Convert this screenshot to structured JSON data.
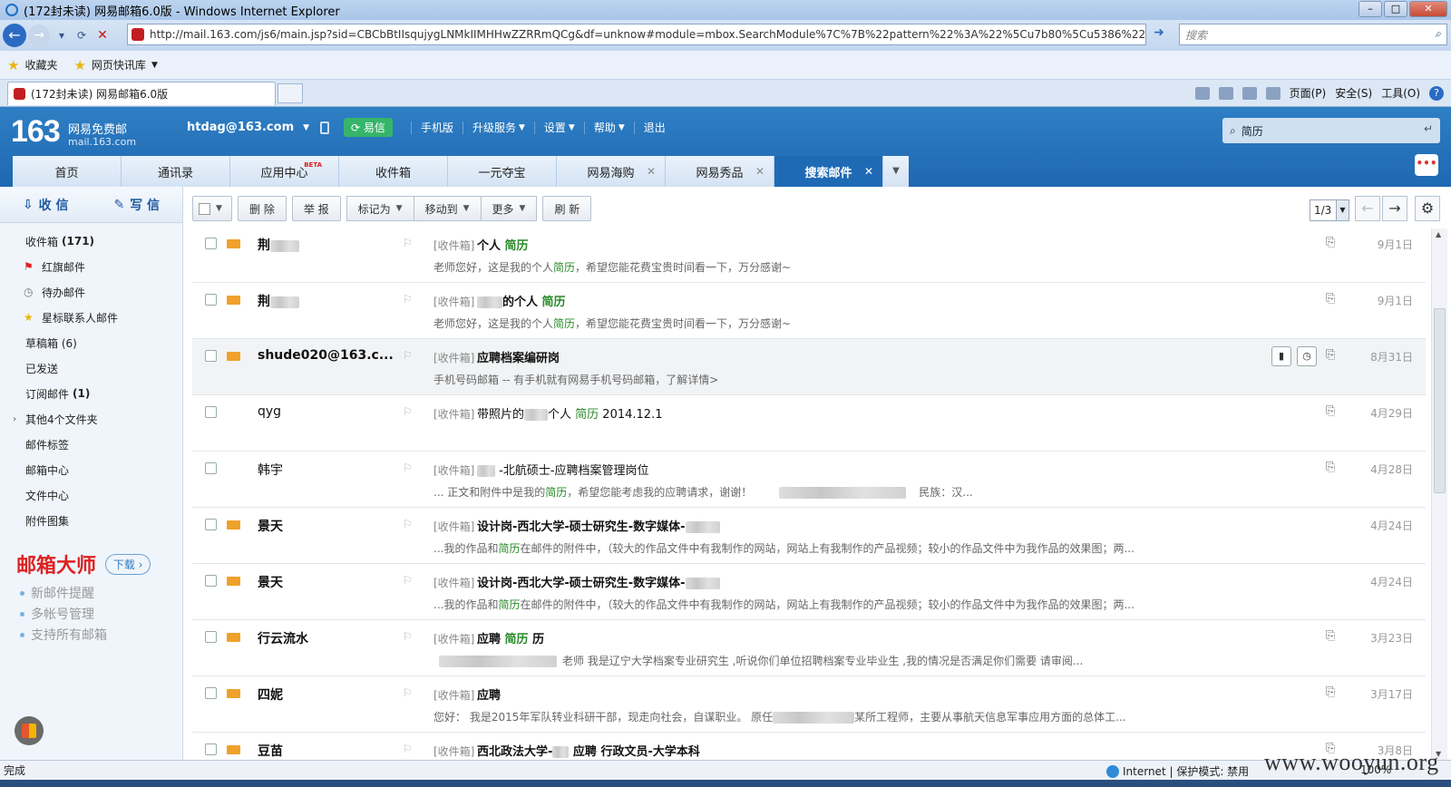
{
  "window": {
    "title": "(172封未读) 网易邮箱6.0版 - Windows Internet Explorer",
    "url": "http://mail.163.com/js6/main.jsp?sid=CBCbBtIIsqujygLNMkIIMHHwZZRRmQCg&df=unknow#module=mbox.SearchModule%7C%7B%22pattern%22%3A%22%5Cu7b80%5Cu5386%22%2C",
    "search_placeholder": "搜索",
    "favorites": "收藏夹",
    "quick_sites": "网页快讯库",
    "tab_title": "(172封未读) 网易邮箱6.0版",
    "tools": [
      "页面(P)",
      "安全(S)",
      "工具(O)"
    ]
  },
  "header": {
    "logo_num": "163",
    "logo_text": "网易免费邮",
    "logo_domain": "mail.163.com",
    "account": "htdag@163.com",
    "yixin": "易信",
    "links": [
      "手机版",
      "升级服务",
      "设置",
      "帮助",
      "退出"
    ],
    "search_value": "简历"
  },
  "tabs": [
    {
      "label": "首页",
      "closable": false,
      "badge": ""
    },
    {
      "label": "通讯录",
      "closable": false,
      "badge": ""
    },
    {
      "label": "应用中心",
      "closable": false,
      "badge": "BETA"
    },
    {
      "label": "收件箱",
      "closable": false,
      "badge": ""
    },
    {
      "label": "一元夺宝",
      "closable": false,
      "badge": ""
    },
    {
      "label": "网易海购",
      "closable": true,
      "badge": ""
    },
    {
      "label": "网易秀品",
      "closable": true,
      "badge": ""
    },
    {
      "label": "搜索邮件",
      "closable": true,
      "badge": "",
      "active": true
    }
  ],
  "sidebar": {
    "receive": "收 信",
    "compose": "写 信",
    "items": [
      {
        "label": "收件箱",
        "count": "(171)"
      },
      {
        "label": "红旗邮件",
        "icon": "flag"
      },
      {
        "label": "待办邮件",
        "icon": "clock"
      },
      {
        "label": "星标联系人邮件",
        "icon": "star"
      },
      {
        "label": "草稿箱 (6)"
      },
      {
        "label": "已发送"
      },
      {
        "label": "订阅邮件",
        "count": "(1)"
      },
      {
        "label": "其他4个文件夹",
        "arrow": true
      },
      {
        "label": "邮件标签"
      },
      {
        "label": "邮箱中心"
      },
      {
        "label": "文件中心"
      },
      {
        "label": "附件图集"
      }
    ],
    "promo_title": "邮箱大师",
    "promo_download": "下载",
    "promo_items": [
      "新邮件提醒",
      "多帐号管理",
      "支持所有邮箱"
    ]
  },
  "toolbar": {
    "buttons": [
      "删 除",
      "举 报"
    ],
    "menus": [
      "标记为",
      "移动到",
      "更多"
    ],
    "refresh": "刷 新",
    "page": "1/3"
  },
  "mails": [
    {
      "sender": "荆",
      "unread": true,
      "folder": "[收件箱]",
      "subject": [
        "个人 ",
        "简历",
        ""
      ],
      "preview": [
        "老师您好，这是我的个人",
        "简历",
        "，希望您能花费宝贵时间看一下，万分感谢~"
      ],
      "date": "9月1日"
    },
    {
      "sender": "荆",
      "unread": true,
      "folder": "[收件箱]",
      "subject": [
        "的个人 ",
        "简历",
        ""
      ],
      "preview": [
        "老师您好，这是我的个人",
        "简历",
        "，希望您能花费宝贵时间看一下，万分感谢~"
      ],
      "date": "9月1日"
    },
    {
      "sender": "shude020@163.c...",
      "unread": true,
      "folder": "[收件箱]",
      "subject": [
        "应聘档案编研岗",
        "",
        ""
      ],
      "preview": [
        "手机号码邮箱 -- 有手机就有网易手机号码邮箱，了解详情>",
        "",
        ""
      ],
      "date": "8月31日"
    },
    {
      "sender": "qyg",
      "unread": false,
      "folder": "[收件箱]",
      "subject": [
        "带照片的",
        "简历",
        " 2014.12.1"
      ],
      "subject_mid": "个人 ",
      "preview": [
        "",
        "",
        ""
      ],
      "date": "4月29日"
    },
    {
      "sender": "韩宇",
      "unread": false,
      "folder": "[收件箱]",
      "subject": [
        " -北航硕士-应聘档案管理岗位",
        "",
        ""
      ],
      "preview": [
        "... 正文和附件中是我的",
        "简历",
        "，希望您能考虑我的应聘请求，谢谢！"
      ],
      "preview_tail": "民族：汉...",
      "date": "4月28日"
    },
    {
      "sender": "景天",
      "unread": true,
      "folder": "[收件箱]",
      "subject": [
        "设计岗-西北大学-硕士研究生-数字媒体-",
        "",
        ""
      ],
      "preview": [
        "...我的作品和",
        "简历",
        "在邮件的附件中，（较大的作品文件中有我制作的网站，网站上有我制作的产品视频；较小的作品文件中为我作品的效果图；两..."
      ],
      "date": "4月24日"
    },
    {
      "sender": "景天",
      "unread": true,
      "folder": "[收件箱]",
      "subject": [
        "设计岗-西北大学-硕士研究生-数字媒体-",
        "",
        ""
      ],
      "preview": [
        "...我的作品和",
        "简历",
        "在邮件的附件中，（较大的作品文件中有我制作的网站，网站上有我制作的产品视频；较小的作品文件中为我作品的效果图；两..."
      ],
      "date": "4月24日"
    },
    {
      "sender": "行云流水",
      "unread": true,
      "folder": "[收件箱]",
      "subject": [
        "应聘 ",
        "简历",
        " 历"
      ],
      "preview": [
        "老师    我是辽宁大学档案专业研究生 ,听说你们单位招聘档案专业毕业生 ,我的情况是否满足你们需要  请审阅...",
        "",
        ""
      ],
      "date": "3月23日"
    },
    {
      "sender": "四妮",
      "unread": true,
      "folder": "[收件箱]",
      "subject": [
        "应聘",
        "",
        ""
      ],
      "preview": [
        "您好：    我是2015年军队转业科研干部，现走向社会，自谋职业。      原任",
        "",
        "某所工程师，主要从事航天信息军事应用方面的总体工..."
      ],
      "date": "3月17日"
    },
    {
      "sender": "豆苗",
      "unread": true,
      "folder": "[收件箱]",
      "subject": [
        "西北政法大学-",
        "",
        " 应聘 行政文员-大学本科"
      ],
      "preview": [
        "",
        "",
        ""
      ],
      "date": "3月8日"
    }
  ],
  "status": {
    "left": "完成",
    "zone": "Internet | 保护模式: 禁用",
    "zoom": "100%"
  },
  "watermark": "www.wooyun.org",
  "colors": {
    "accent": "#1f6ab5",
    "keyword": "#2a8a2a",
    "unread_env": "#f0a12a"
  }
}
